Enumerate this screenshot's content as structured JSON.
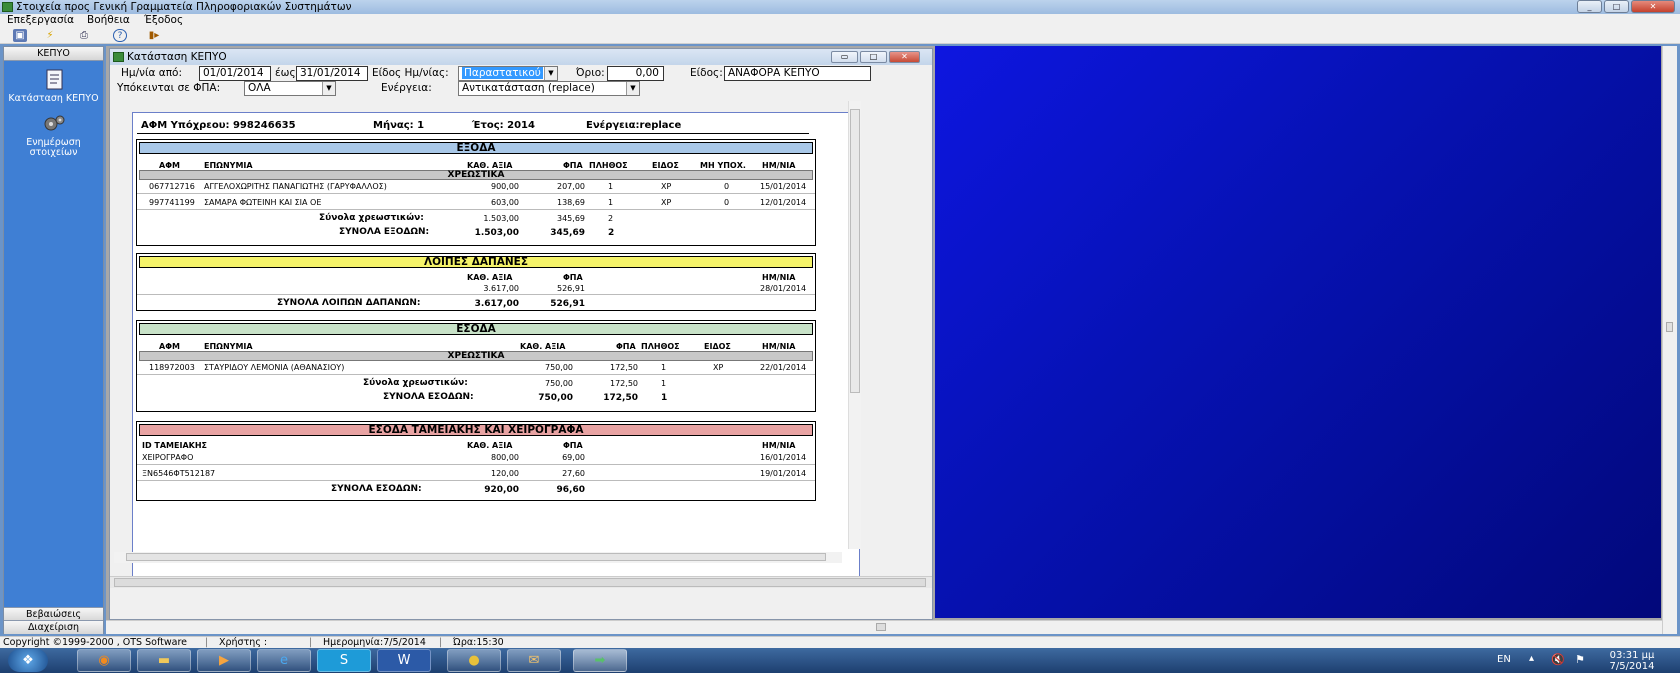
{
  "window": {
    "title": "Στοιχεία προς Γενική Γραμματεία Πληροφοριακών Συστημάτων"
  },
  "menu": [
    "Επεξεργασία",
    "Βοήθεια",
    "Έξοδος"
  ],
  "toolbar_icons": [
    "save-icon",
    "lightning-icon",
    "print-icon",
    "help-icon",
    "exit-icon"
  ],
  "sidebar": {
    "header": "ΚΕΠΥΟ",
    "items": [
      {
        "label": "Κατάσταση ΚΕΠΥΟ",
        "icon": "report-icon"
      },
      {
        "label": "Ενημέρωση στοιχείων",
        "icon": "gears-icon"
      }
    ],
    "bottom": [
      "Βεβαιώσεις",
      "Διαχείριση"
    ]
  },
  "child": {
    "title": "Κατάσταση ΚΕΠΥΟ",
    "filters": {
      "date_from_label": "Ημ/νία από:",
      "date_from": "01/01/2014",
      "date_to_label": "έως",
      "date_to": "31/01/2014",
      "date_type_label": "Είδος Ημ/νίας:",
      "date_type": "Παραστατικού",
      "limit_label": "Όριο:",
      "limit": "0,00",
      "kind_label": "Είδος:",
      "kind": "ΑΝΑΦΟΡΑ ΚΕΠΥΟ",
      "vat_label": "Υπόκεινται σε ΦΠΑ:",
      "vat": "ΟΛΑ",
      "action_label": "Ενέργεια:",
      "action": "Αντικατάσταση (replace)"
    },
    "report": {
      "afm": "ΑΦΜ Υπόχρεου: 998246635",
      "month": "Μήνας: 1",
      "year": "Έτος: 2014",
      "action": "Ενέργεια:replace",
      "exoda": {
        "title": "ΕΞΟΔΑ",
        "headers": {
          "afm": "ΑΦΜ",
          "name": "ΕΠΩΝΥΜΙΑ",
          "net": "ΚΑΘ. ΑΞΙΑ",
          "vat": "ΦΠΑ",
          "count": "ΠΛΗΘΟΣ",
          "kind": "ΕΙΔΟΣ",
          "nonsub": "ΜΗ ΥΠΟΧ.",
          "date": "ΗΜ/ΝΙΑ"
        },
        "sub": "ΧΡΕΩΣΤΙΚΑ",
        "rows": [
          {
            "afm": "067712716",
            "name": "ΑΓΓΕΛΟΧΩΡΙΤΗΣ ΠΑΝΑΓΙΩΤΗΣ (ΓΑΡΥΦΑΛΛΟΣ)",
            "net": "900,00",
            "vat": "207,00",
            "count": "1",
            "kind": "ΧΡ",
            "nonsub": "0",
            "date": "15/01/2014"
          },
          {
            "afm": "997741199",
            "name": "ΣΑΜΑΡΑ ΦΩΤΕΙΝΗ ΚΑΙ ΣΙΑ ΟΕ",
            "net": "603,00",
            "vat": "138,69",
            "count": "1",
            "kind": "ΧΡ",
            "nonsub": "0",
            "date": "12/01/2014"
          }
        ],
        "sub_total_label": "Σύνολα χρεωστικών:",
        "sub_total": {
          "net": "1.503,00",
          "vat": "345,69",
          "count": "2"
        },
        "total_label": "ΣΥΝΟΛΑ ΕΞΟΔΩΝ:",
        "total": {
          "net": "1.503,00",
          "vat": "345,69",
          "count": "2"
        }
      },
      "loipes": {
        "title": "ΛΟΙΠΕΣ ΔΑΠΑΝΕΣ",
        "headers": {
          "net": "ΚΑΘ. ΑΞΙΑ",
          "vat": "ΦΠΑ",
          "date": "ΗΜ/ΝΙΑ"
        },
        "row": {
          "net": "3.617,00",
          "vat": "526,91",
          "date": "28/01/2014"
        },
        "total_label": "ΣΥΝΟΛΑ ΛΟΙΠΩΝ ΔΑΠΑΝΩΝ:",
        "total": {
          "net": "3.617,00",
          "vat": "526,91"
        }
      },
      "esoda": {
        "title": "ΕΣΟΔΑ",
        "headers": {
          "afm": "ΑΦΜ",
          "name": "ΕΠΩΝΥΜΙΑ",
          "net": "ΚΑΘ. ΑΞΙΑ",
          "vat": "ΦΠΑ",
          "count": "ΠΛΗΘΟΣ",
          "kind": "ΕΙΔΟΣ",
          "date": "ΗΜ/ΝΙΑ"
        },
        "sub": "ΧΡΕΩΣΤΙΚΑ",
        "row": {
          "afm": "118972003",
          "name": "ΣΤΑΥΡΙΔΟΥ ΛΕΜΟΝΙΑ (ΑΘΑΝΑΣΙΟΥ)",
          "net": "750,00",
          "vat": "172,50",
          "count": "1",
          "kind": "ΧΡ",
          "date": "22/01/2014"
        },
        "sub_total_label": "Σύνολα χρεωστικών:",
        "sub_total": {
          "net": "750,00",
          "vat": "172,50",
          "count": "1"
        },
        "total_label": "ΣΥΝΟΛΑ ΕΣΟΔΩΝ:",
        "total": {
          "net": "750,00",
          "vat": "172,50",
          "count": "1"
        }
      },
      "tameiakis": {
        "title": "ΕΣΟΔΑ ΤΑΜΕΙΑΚΗΣ ΚΑΙ ΧΕΙΡΟΓΡΑΦΑ",
        "headers": {
          "id": "ID ΤΑΜΕΙΑΚΗΣ",
          "net": "ΚΑΘ. ΑΞΙΑ",
          "vat": "ΦΠΑ",
          "date": "ΗΜ/ΝΙΑ"
        },
        "rows": [
          {
            "id": "ΧΕΙΡΟΓΡΑΦΟ",
            "net": "800,00",
            "vat": "69,00",
            "date": "16/01/2014"
          },
          {
            "id": "ΞΝ6546ΦΤ512187",
            "net": "120,00",
            "vat": "27,60",
            "date": "19/01/2014"
          }
        ],
        "total_label": "ΣΥΝΟΛΑ ΕΣΟΔΩΝ:",
        "total": {
          "net": "920,00",
          "vat": "96,60"
        }
      }
    }
  },
  "statusbar": {
    "copyright": "Copyright ©1999-2000 , OTS Software",
    "user": "Χρήστης :",
    "date": "Ημερομηνία:7/5/2014",
    "time": "Ώρα:15:30"
  },
  "taskbar": {
    "apps": [
      "start-orb-icon",
      "firefox-icon",
      "explorer-icon",
      "media-player-icon",
      "ie-icon",
      "skype-icon",
      "word-icon",
      "coins-icon",
      "outlook-icon",
      "app-icon"
    ],
    "lang": "EN",
    "clock_time": "03:31 μμ",
    "clock_date": "7/5/2014"
  }
}
